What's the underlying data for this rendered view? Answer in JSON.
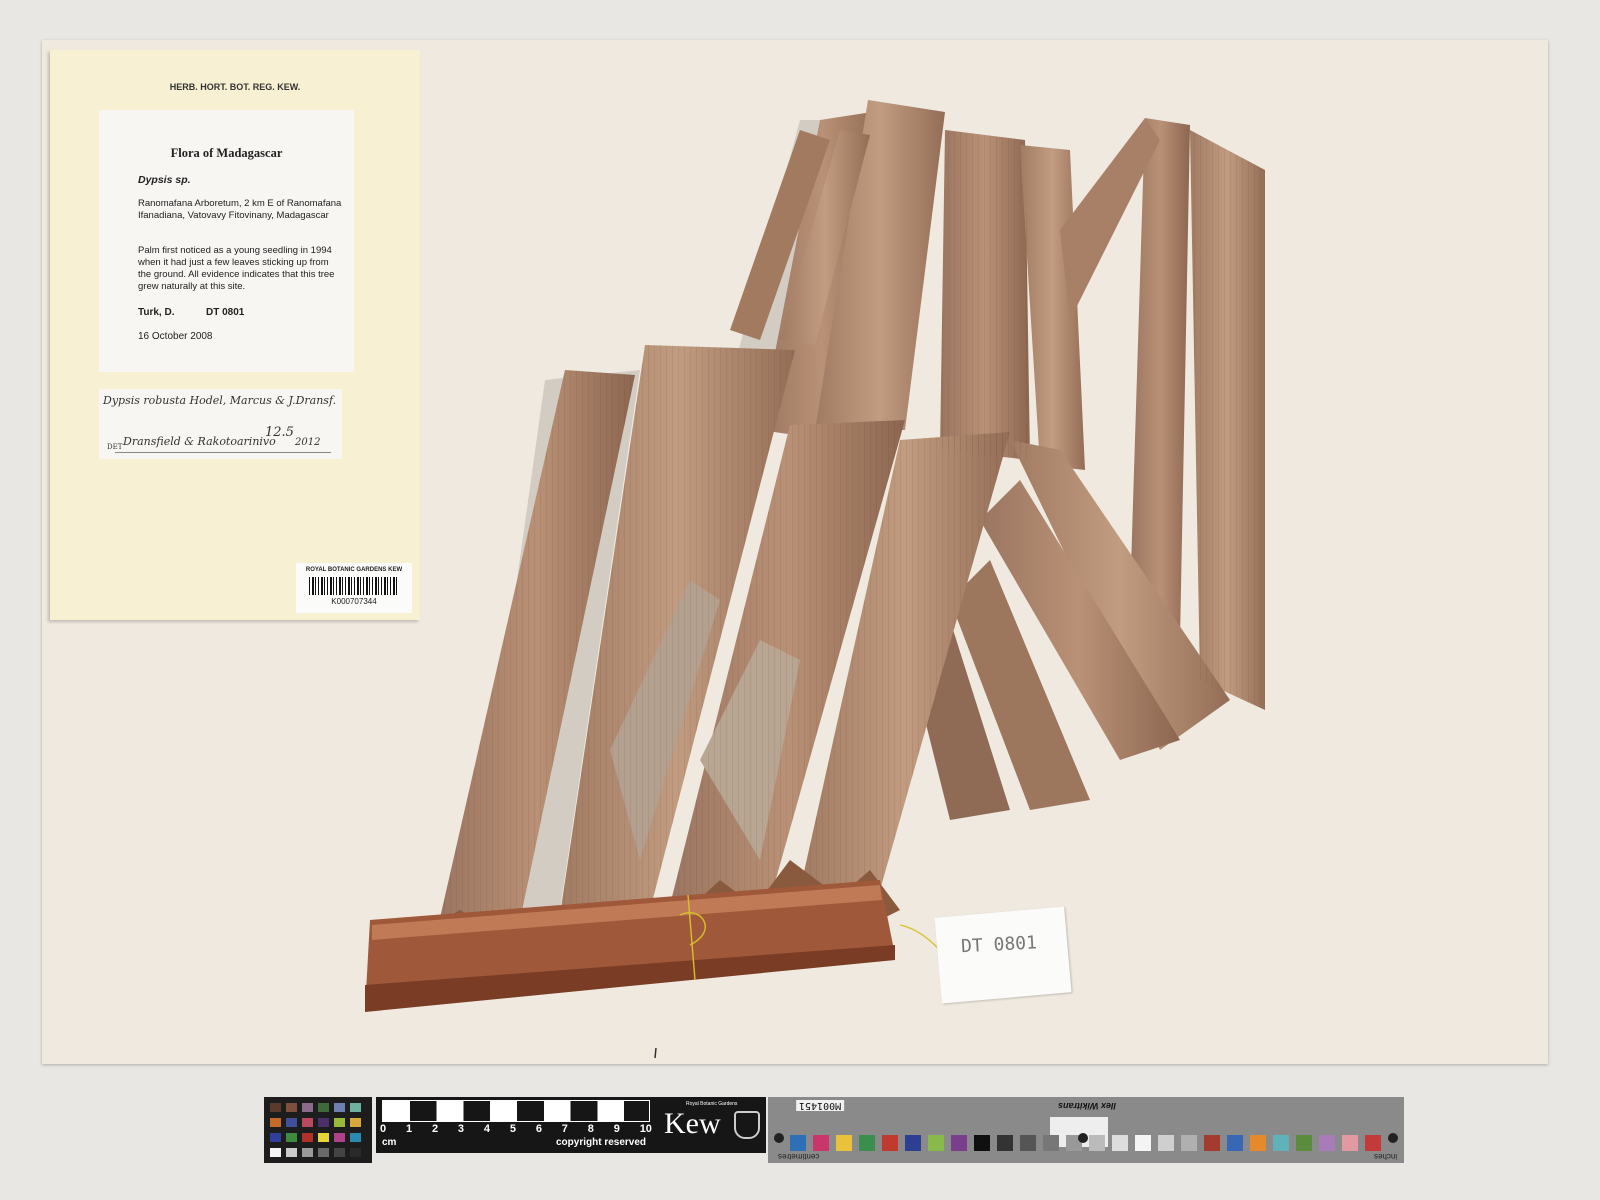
{
  "herbarium": {
    "title": "HERB. HORT. BOT. REG. KEW."
  },
  "label": {
    "flora": "Flora of Madagascar",
    "taxon": "Dypsis sp.",
    "locality": "Ranomafana Arboretum, 2 km E of Ranomafana Ifanadiana, Vatovavy Fitovinany, Madagascar",
    "notes": "Palm first noticed as a young seedling in 1994 when it had just a few leaves sticking up from the ground. All evidence indicates that this tree grew naturally at this site.",
    "collector": "Turk, D.",
    "number": "DT  0801",
    "date": "16 October 2008"
  },
  "determination": {
    "name": "Dypsis robusta Hodel, Marcus & J.Dransf.",
    "det_prefix": "DET",
    "determiner": "Dransfield & Rakotoarinivo",
    "date": "12.5",
    "year": "2012"
  },
  "barcode": {
    "institution": "ROYAL BOTANIC GARDENS KEW",
    "code": "K000707344"
  },
  "tag": {
    "text": "DT 0801"
  },
  "scale": {
    "numbers": [
      "0",
      "1",
      "2",
      "3",
      "4",
      "5",
      "6",
      "7",
      "8",
      "9",
      "10"
    ],
    "unit": "cm",
    "copyright": "copyright reserved"
  },
  "kew": {
    "logo": "Kew",
    "small": "Royal Botanic Gardens"
  },
  "colorbar": {
    "id": "M001451",
    "brand": "Ilex Wikitrans",
    "cm_label": "centimetres",
    "inch_label": "inches",
    "swatches": [
      "#2e6fb5",
      "#c8366b",
      "#e9c13a",
      "#3a8f4f",
      "#c03a2e",
      "#2c3f92",
      "#88b94a",
      "#7a3f8c",
      "#101010",
      "#333333",
      "#555555",
      "#777777",
      "#999999",
      "#bbbbbb",
      "#dddddd",
      "#f4f4f4",
      "#cfcfcf",
      "#b0b0b0",
      "#a33c2e",
      "#3867b5",
      "#e48a2a",
      "#5fb2b8",
      "#5b8c3d",
      "#a77cb8",
      "#e19aa1",
      "#c23a3a"
    ]
  },
  "swatch_grid": [
    "#5a3a2a",
    "#7d4f3c",
    "#8a6c8a",
    "#3e6a3a",
    "#6e7fb0",
    "#6fb0a0",
    "#c46b2a",
    "#3f4f9a",
    "#b84a60",
    "#4a2f6a",
    "#9ab83a",
    "#d9a83a",
    "#2f3f9a",
    "#3e8a3e",
    "#b0302a",
    "#e8d23a",
    "#b0408a",
    "#2a8ab0",
    "#f4f4f4",
    "#cccccc",
    "#9a9a9a",
    "#6a6a6a",
    "#444444",
    "#2a2a2a"
  ]
}
